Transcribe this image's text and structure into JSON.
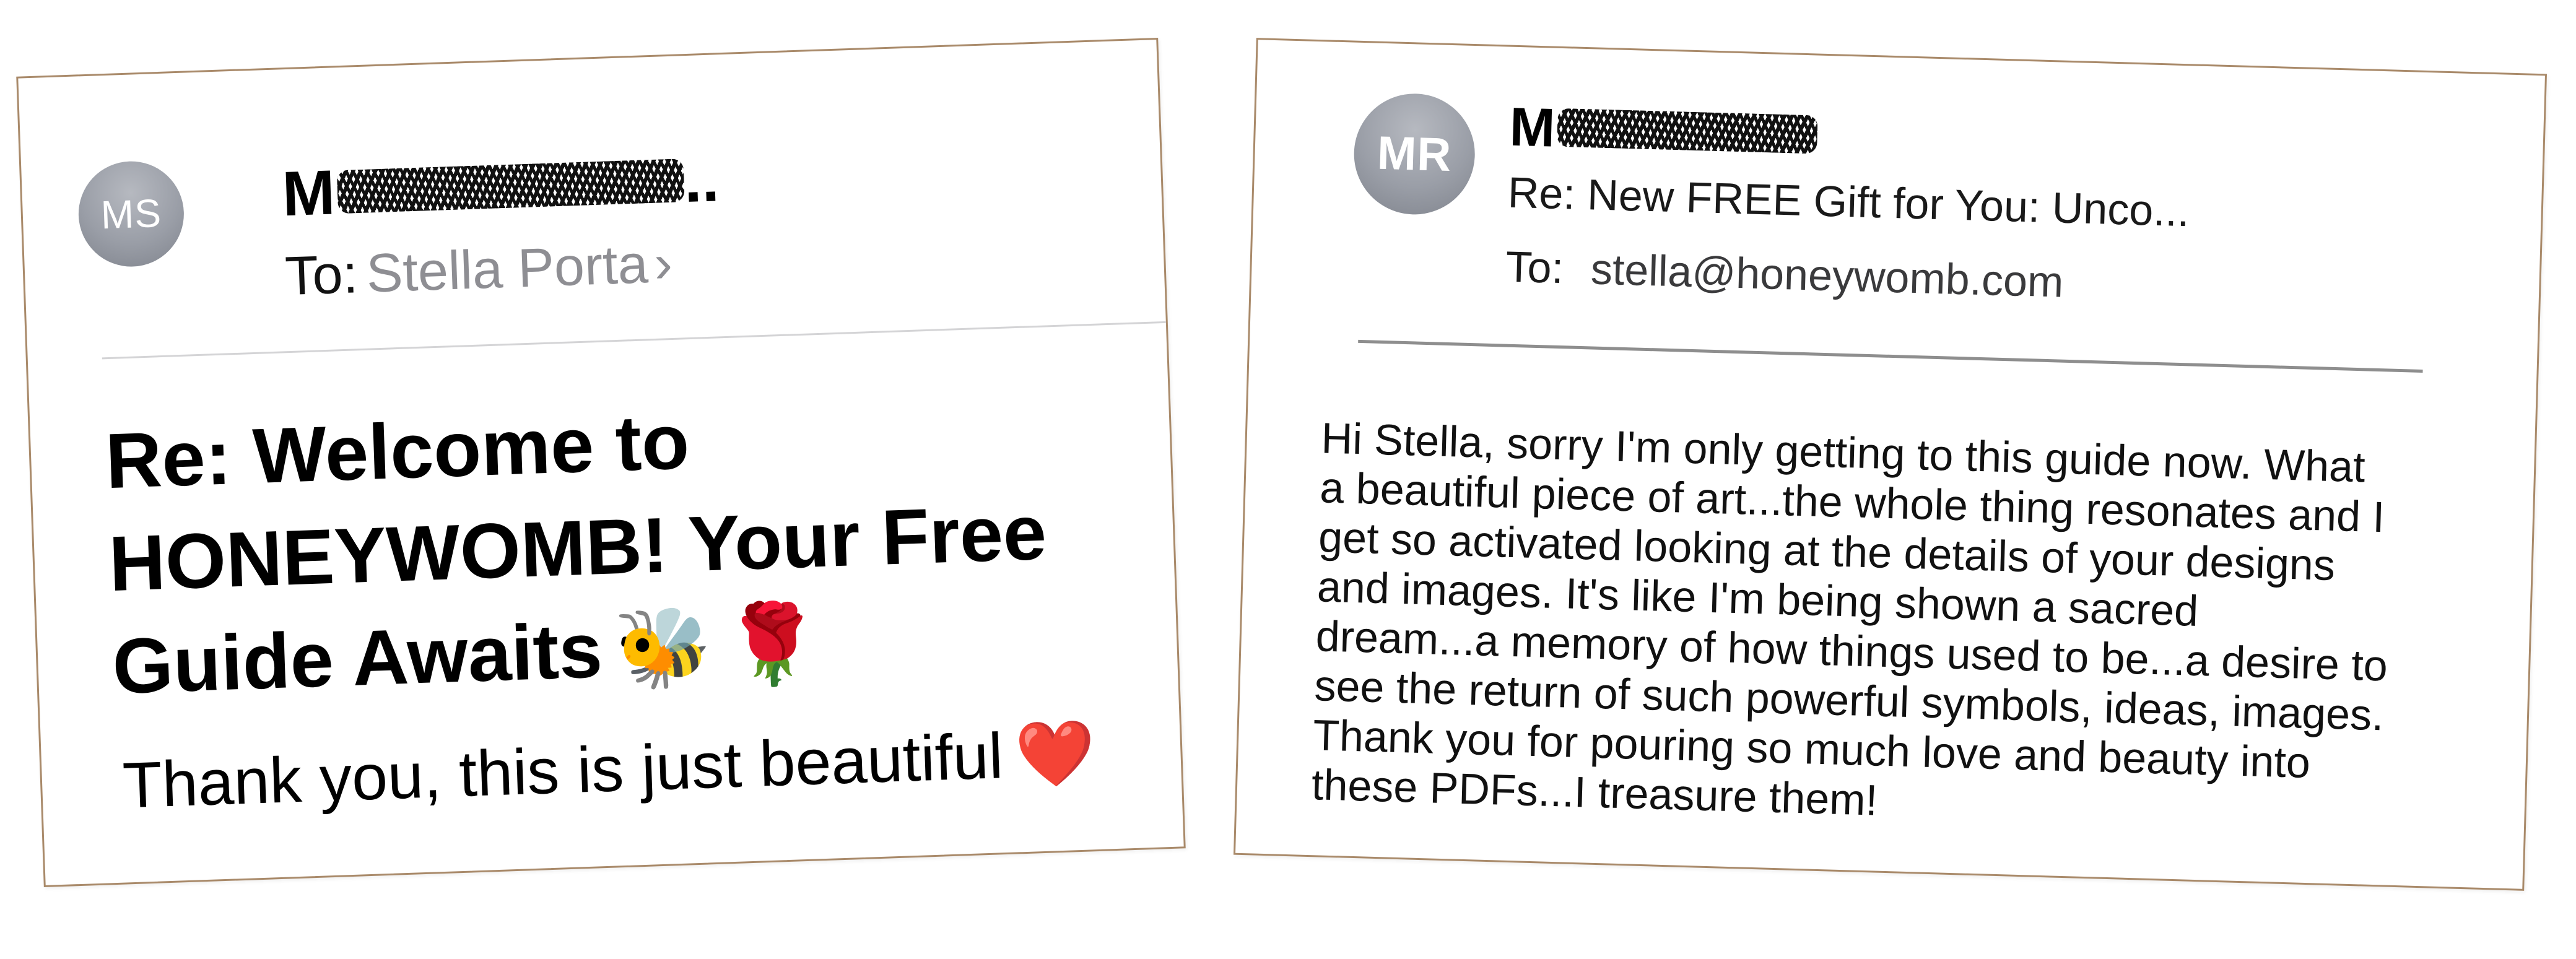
{
  "left_card": {
    "avatar_initials": "MS",
    "sender_visible": "M",
    "sender_ellipsis": "..",
    "to_label": "To:",
    "to_name": "Stella Porta",
    "to_chevron": "›",
    "subject_line1": "Re: Welcome to",
    "subject_line2": "HONEYWOMB! Your Free",
    "subject_line3": "Guide Awaits",
    "subject_emoji_bee": "🐝",
    "subject_emoji_rose": "🌹",
    "body_text": "Thank you, this is just beautiful",
    "body_emoji": "❤️"
  },
  "right_card": {
    "avatar_initials": "MR",
    "sender_visible": "M",
    "subject": "Re: New FREE Gift for You: Unco...",
    "to_label": "To:",
    "to_email": "stella@honeywomb.com",
    "body_lines": [
      "Hi Stella, sorry I'm only getting to this guide now. What",
      "a beautiful piece of art...the whole thing resonates and I",
      "get so activated looking at the details of your designs",
      "and images. It's like I'm being shown a sacred",
      "dream...a memory of how things used to be...a desire to",
      "see the return of such powerful symbols, ideas, images.",
      "Thank you for pouring so much love and beauty into",
      "these PDFs...I treasure them!"
    ]
  },
  "colors": {
    "card_border": "#a98a6a",
    "avatar_gray": "#9a9ea7",
    "secondary_text": "#8e8e93",
    "heart_red": "#e3212c",
    "divider_light": "#d4d4d6",
    "divider_dark": "#8e8e8e"
  },
  "icons": {
    "redaction": "scribble-redaction",
    "chevron": "chevron-right-icon",
    "heart": "red-heart-emoji",
    "bee": "honeybee-emoji",
    "rose": "rose-emoji"
  }
}
